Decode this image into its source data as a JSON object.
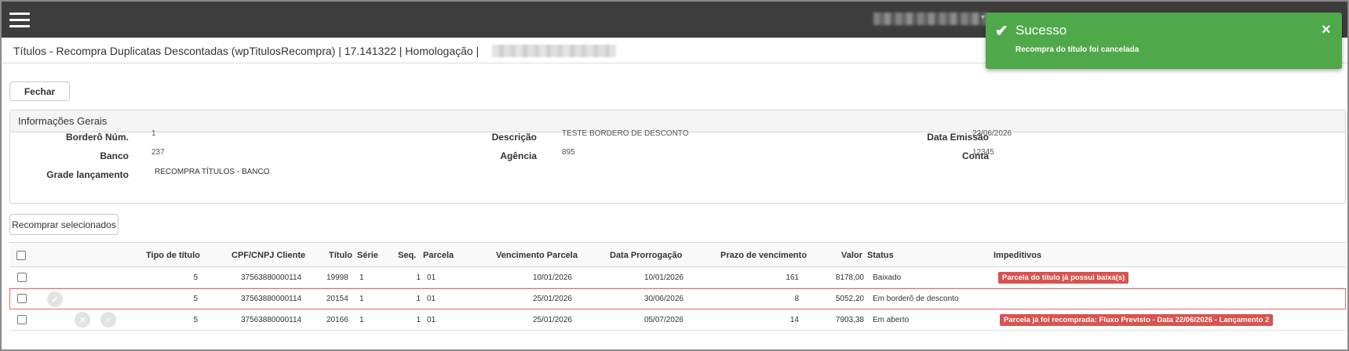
{
  "header": {
    "menu_icon": "hamburger-menu-icon"
  },
  "page": {
    "title": "Títulos - Recompra Duplicatas Descontadas (wpTitulosRecompra) | 17.141322 | Homologação |"
  },
  "buttons": {
    "fechar": "Fechar",
    "recomprar_selecionados": "Recomprar selecionados"
  },
  "info_panel": {
    "title": "Informações Gerais",
    "fields": {
      "bordero_num_label": "Borderô Núm.",
      "bordero_num_value": "1",
      "descricao_label": "Descrição",
      "descricao_value": "TESTE BORDERO DE DESCONTO",
      "data_emissao_label": "Data Emissão",
      "data_emissao_value": "22/06/2026",
      "banco_label": "Banco",
      "banco_value": "237",
      "agencia_label": "Agência",
      "agencia_value": "895",
      "conta_label": "Conta",
      "conta_value": "12345",
      "grade_label": "Grade lançamento",
      "grade_value": "RECOMPRA TÍTULOS - BANCO"
    }
  },
  "table": {
    "headers": {
      "tipo_titulo": "Tipo de título",
      "cpf_cnpj": "CPF/CNPJ Cliente",
      "titulo": "Título",
      "serie": "Série",
      "seq": "Seq.",
      "parcela": "Parcela",
      "vencimento": "Vencimento Parcela",
      "prorrogacao": "Data Prorrogação",
      "prazo": "Prazo de vencimento",
      "valor": "Valor",
      "status": "Status",
      "impeditivos": "Impeditivos"
    },
    "rows": [
      {
        "tipo": "5",
        "cpf": "37563880000114",
        "titulo": "19998",
        "serie": "1",
        "seq": "1",
        "parcela": "01",
        "vencimento": "10/01/2026",
        "prorrogacao": "10/01/2026",
        "prazo": "161",
        "valor": "8178,00",
        "status": "Baixado",
        "impeditivo": "Parcela do título já possui baixa(s)"
      },
      {
        "tipo": "5",
        "cpf": "37563880000114",
        "titulo": "20154",
        "serie": "1",
        "seq": "1",
        "parcela": "01",
        "vencimento": "25/01/2026",
        "prorrogacao": "30/06/2026",
        "prazo": "8",
        "valor": "5052,20",
        "status": "Em borderô de desconto",
        "impeditivo": ""
      },
      {
        "tipo": "5",
        "cpf": "37563880000114",
        "titulo": "20166",
        "serie": "1",
        "seq": "1",
        "parcela": "01",
        "vencimento": "25/01/2026",
        "prorrogacao": "05/07/2026",
        "prazo": "14",
        "valor": "7903,38",
        "status": "Em aberto",
        "impeditivo": "Parcela já foi recomprada: Fluxo Previsto - Data 22/06/2026 - Lançamento 2"
      }
    ]
  },
  "toast": {
    "title": "Sucesso",
    "message": "Recompra do título foi cancelada",
    "close": "×",
    "check": "✔"
  },
  "colors": {
    "topbar": "#3d3d3d",
    "toast_success": "#4fa84a",
    "badge_danger": "#d9534f",
    "selected_row_border": "#e46a6a"
  }
}
